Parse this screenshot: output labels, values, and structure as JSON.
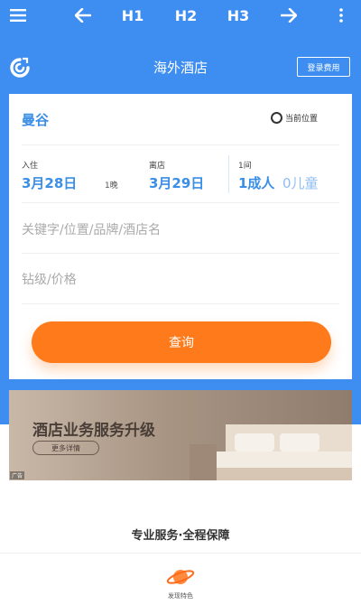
{
  "toolbar": {
    "menu_icon": "hamburger-icon",
    "back_icon": "arrow-left-icon",
    "h1": "H1",
    "h2": "H2",
    "h3": "H3",
    "forward_icon": "arrow-right-icon",
    "more_icon": "kebab-icon"
  },
  "header": {
    "logo_icon": "app-logo-icon",
    "title": "海外酒店",
    "order_button": "登录费用"
  },
  "form": {
    "destination": "曼谷",
    "current_location": "当前位置",
    "checkin_label": "入住",
    "checkin_date": "3月28日",
    "nights": "1晚",
    "checkout_label": "离店",
    "checkout_date": "3月29日",
    "room_label": "1间",
    "adults": "1成人",
    "children": "0儿童",
    "keyword_placeholder": "关键字/位置/品牌/酒店名",
    "star_price_placeholder": "钻级/价格",
    "search_button": "查询"
  },
  "banner": {
    "title": "酒店业务服务升级",
    "more": "更多详情",
    "tag": "广告"
  },
  "footer": {
    "tagline": "专业服务·全程保障",
    "feature_icon": "planet-icon",
    "feature_label": "发现特色"
  },
  "colors": {
    "primary_blue": "#3d8ef0",
    "accent_orange": "#ff7a1a",
    "link_blue": "#3a8ee6"
  }
}
